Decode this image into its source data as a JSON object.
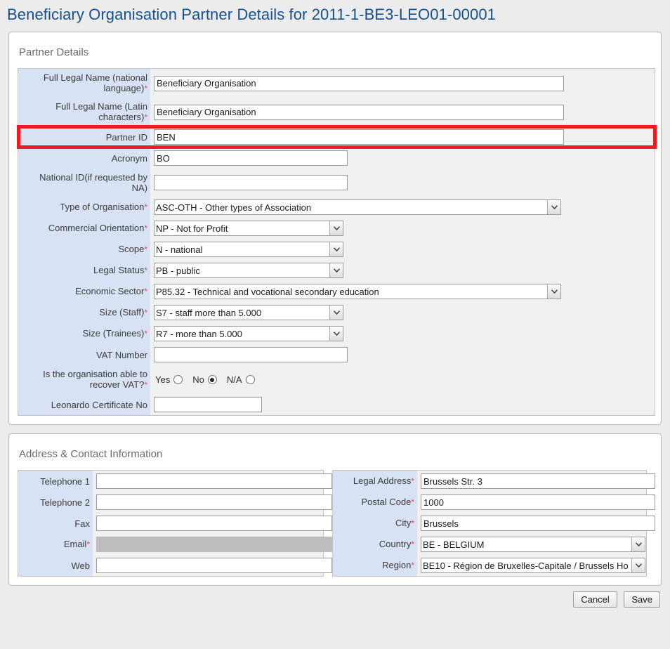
{
  "page": {
    "title": "Beneficiary Organisation Partner Details for 2011-1-BE3-LEO01-00001",
    "title_color": "#18508e",
    "background": "#ececec",
    "label_column_color": "#d7e3f4",
    "required_marker": "*",
    "highlight_color": "#ed1c24"
  },
  "partner_details": {
    "heading": "Partner Details",
    "fields": [
      {
        "label": "Full Legal Name (national language)",
        "required": true,
        "type": "text",
        "value": "Beneficiary Organisation",
        "placeholder": "",
        "name": "full-legal-name-national"
      },
      {
        "label": "Full Legal Name (Latin characters)",
        "required": true,
        "type": "text",
        "value": "Beneficiary Organisation",
        "placeholder": "",
        "name": "full-legal-name-latin"
      },
      {
        "label": "Partner ID",
        "required": false,
        "type": "text",
        "value": "BEN",
        "placeholder": "",
        "name": "partner-id",
        "highlighted": true
      },
      {
        "label": "Acronym",
        "required": false,
        "type": "text",
        "value": "BO",
        "placeholder": "",
        "name": "acronym"
      },
      {
        "label": "National ID(if requested by NA)",
        "required": false,
        "type": "text",
        "value": "",
        "placeholder": "",
        "name": "national-id"
      },
      {
        "label": "Type of Organisation",
        "required": true,
        "type": "select",
        "value": "ASC-OTH - Other types of Association",
        "name": "type-of-organisation"
      },
      {
        "label": "Commercial Orientation",
        "required": true,
        "type": "select",
        "value": "NP - Not for Profit",
        "name": "commercial-orientation"
      },
      {
        "label": "Scope",
        "required": true,
        "type": "select",
        "value": "N - national",
        "name": "scope"
      },
      {
        "label": "Legal Status",
        "required": true,
        "type": "select",
        "value": "PB - public",
        "name": "legal-status"
      },
      {
        "label": "Economic Sector",
        "required": true,
        "type": "select",
        "value": "P85.32 - Technical and vocational secondary education",
        "name": "economic-sector"
      },
      {
        "label": "Size (Staff)",
        "required": true,
        "type": "select",
        "value": "S7 - staff more than 5.000",
        "name": "size-staff"
      },
      {
        "label": "Size (Trainees)",
        "required": true,
        "type": "select",
        "value": "R7 - more than 5.000",
        "name": "size-trainees"
      },
      {
        "label": "VAT Number",
        "required": false,
        "type": "text",
        "value": "",
        "placeholder": "",
        "name": "vat-number"
      },
      {
        "label": "Is the organisation able to recover VAT?",
        "required": true,
        "type": "radio",
        "name": "recover-vat",
        "options": [
          "Yes",
          "No",
          "N/A"
        ],
        "selected": "No"
      },
      {
        "label": "Leonardo Certificate No",
        "required": false,
        "type": "text",
        "value": "",
        "placeholder": "",
        "name": "leonardo-certificate-no"
      }
    ]
  },
  "address_contact": {
    "heading": "Address & Contact Information",
    "contact_fields": [
      {
        "label": "Telephone 1",
        "required": false,
        "type": "text",
        "value": "",
        "placeholder": "",
        "name": "telephone-1"
      },
      {
        "label": "Telephone 2",
        "required": false,
        "type": "text",
        "value": "",
        "placeholder": "",
        "name": "telephone-2"
      },
      {
        "label": "Fax",
        "required": false,
        "type": "text",
        "value": "",
        "placeholder": "",
        "name": "fax"
      },
      {
        "label": "Email",
        "required": true,
        "type": "text",
        "value": "",
        "placeholder": "",
        "name": "email",
        "disabled": true
      },
      {
        "label": "Web",
        "required": false,
        "type": "text",
        "value": "",
        "placeholder": "",
        "name": "web"
      }
    ],
    "address_fields": [
      {
        "label": "Legal Address",
        "required": true,
        "type": "text",
        "value": "Brussels Str. 3",
        "placeholder": "",
        "name": "legal-address"
      },
      {
        "label": "Postal Code",
        "required": true,
        "type": "text",
        "value": "1000",
        "placeholder": "",
        "name": "postal-code"
      },
      {
        "label": "City",
        "required": true,
        "type": "text",
        "value": "Brussels",
        "placeholder": "",
        "name": "city"
      },
      {
        "label": "Country",
        "required": true,
        "type": "select",
        "value": "BE - BELGIUM",
        "name": "country"
      },
      {
        "label": "Region",
        "required": true,
        "type": "select",
        "value": "BE10 - Région de Bruxelles-Capitale / Brussels Ho",
        "name": "region"
      }
    ]
  },
  "footer": {
    "cancel_label": "Cancel",
    "save_label": "Save"
  }
}
